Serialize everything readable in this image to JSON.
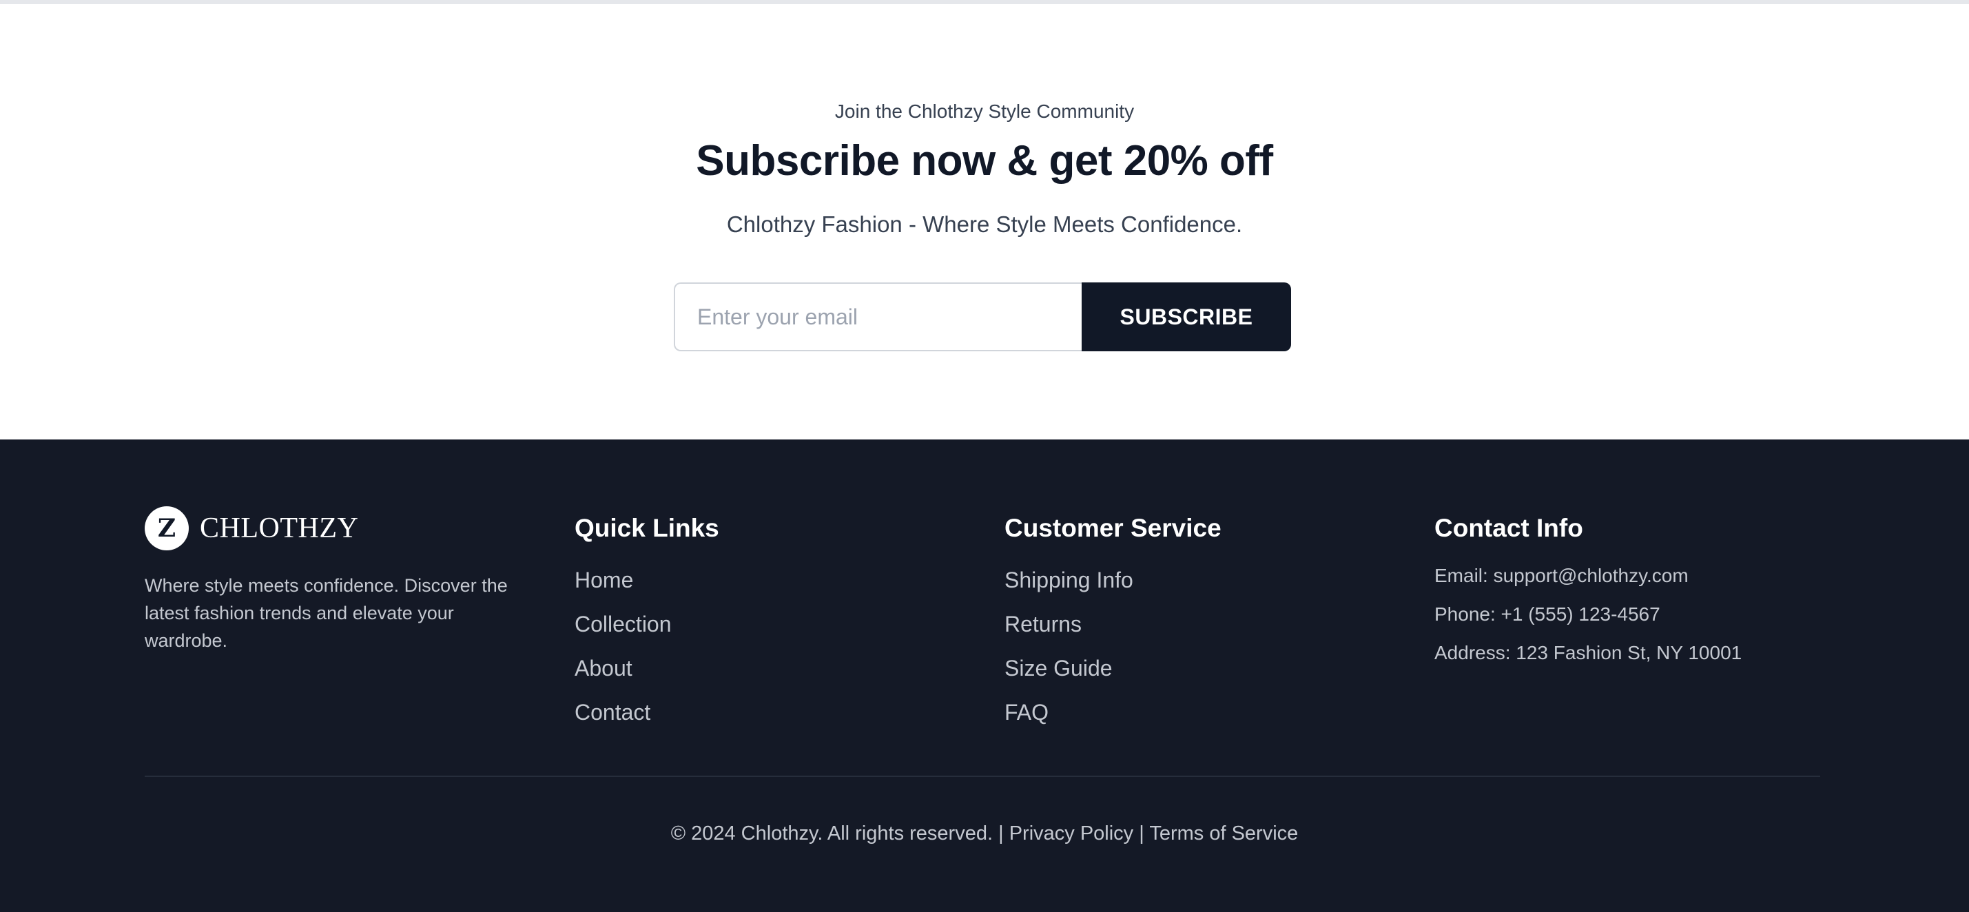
{
  "newsletter": {
    "eyebrow": "Join the Chlothzy Style Community",
    "title": "Subscribe now & get 20% off",
    "tagline": "Chlothzy Fashion - Where Style Meets Confidence.",
    "email_placeholder": "Enter your email",
    "email_value": "",
    "subscribe_label": "SUBSCRIBE"
  },
  "footer": {
    "brand": {
      "logo_letter": "Z",
      "name": "CHLOTHZY",
      "description": "Where style meets confidence. Discover the latest fashion trends and elevate your wardrobe."
    },
    "quick_links": {
      "heading": "Quick Links",
      "items": [
        "Home",
        "Collection",
        "About",
        "Contact"
      ]
    },
    "customer_service": {
      "heading": "Customer Service",
      "items": [
        "Shipping Info",
        "Returns",
        "Size Guide",
        "FAQ"
      ]
    },
    "contact": {
      "heading": "Contact Info",
      "email": "Email: support@chlothzy.com",
      "phone": "Phone: +1 (555) 123-4567",
      "address": "Address: 123 Fashion St, NY 10001"
    },
    "bottom": {
      "copyright": "© 2024 Chlothzy. All rights reserved.",
      "separator": "|",
      "privacy": "Privacy Policy",
      "terms": "Terms of Service"
    }
  },
  "colors": {
    "footer_bg": "#141926",
    "button_bg": "#111827",
    "muted_text": "#c4c8d0"
  }
}
